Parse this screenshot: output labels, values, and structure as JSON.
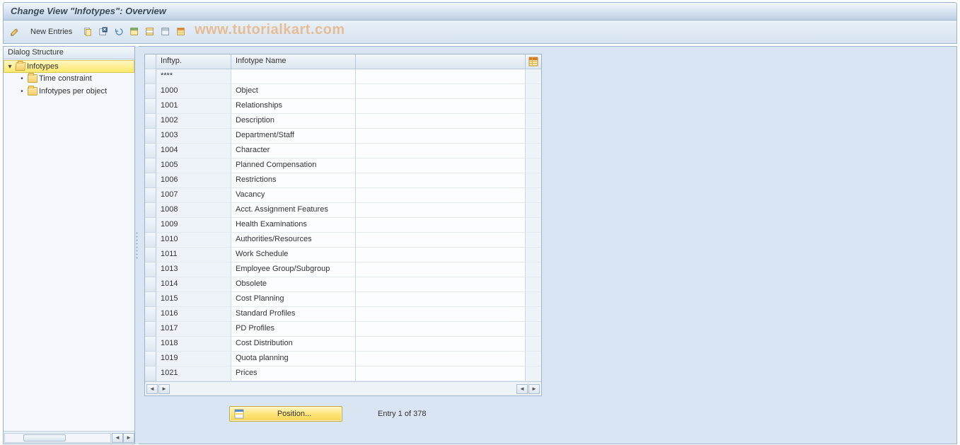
{
  "title": "Change View \"Infotypes\": Overview",
  "toolbar": {
    "new_entries_label": "New Entries"
  },
  "watermark": "www.tutorialkart.com",
  "dialog_structure": {
    "header": "Dialog Structure",
    "root": {
      "label": "Infotypes"
    },
    "children": [
      {
        "label": "Time constraint"
      },
      {
        "label": "Infotypes per object"
      }
    ]
  },
  "grid": {
    "columns": {
      "id": "Inftyp.",
      "name": "Infotype Name"
    },
    "rows": [
      {
        "id": "****",
        "name": ""
      },
      {
        "id": "1000",
        "name": "Object"
      },
      {
        "id": "1001",
        "name": "Relationships"
      },
      {
        "id": "1002",
        "name": "Description"
      },
      {
        "id": "1003",
        "name": "Department/Staff"
      },
      {
        "id": "1004",
        "name": "Character"
      },
      {
        "id": "1005",
        "name": "Planned Compensation"
      },
      {
        "id": "1006",
        "name": "Restrictions"
      },
      {
        "id": "1007",
        "name": "Vacancy"
      },
      {
        "id": "1008",
        "name": "Acct. Assignment Features"
      },
      {
        "id": "1009",
        "name": "Health Examinations"
      },
      {
        "id": "1010",
        "name": "Authorities/Resources"
      },
      {
        "id": "1011",
        "name": "Work Schedule"
      },
      {
        "id": "1013",
        "name": "Employee Group/Subgroup"
      },
      {
        "id": "1014",
        "name": "Obsolete"
      },
      {
        "id": "1015",
        "name": "Cost Planning"
      },
      {
        "id": "1016",
        "name": "Standard Profiles"
      },
      {
        "id": "1017",
        "name": "PD Profiles"
      },
      {
        "id": "1018",
        "name": "Cost Distribution"
      },
      {
        "id": "1019",
        "name": "Quota planning"
      },
      {
        "id": "1021",
        "name": "Prices"
      }
    ]
  },
  "footer": {
    "position_label": "Position...",
    "entry_text": "Entry 1 of 378"
  }
}
